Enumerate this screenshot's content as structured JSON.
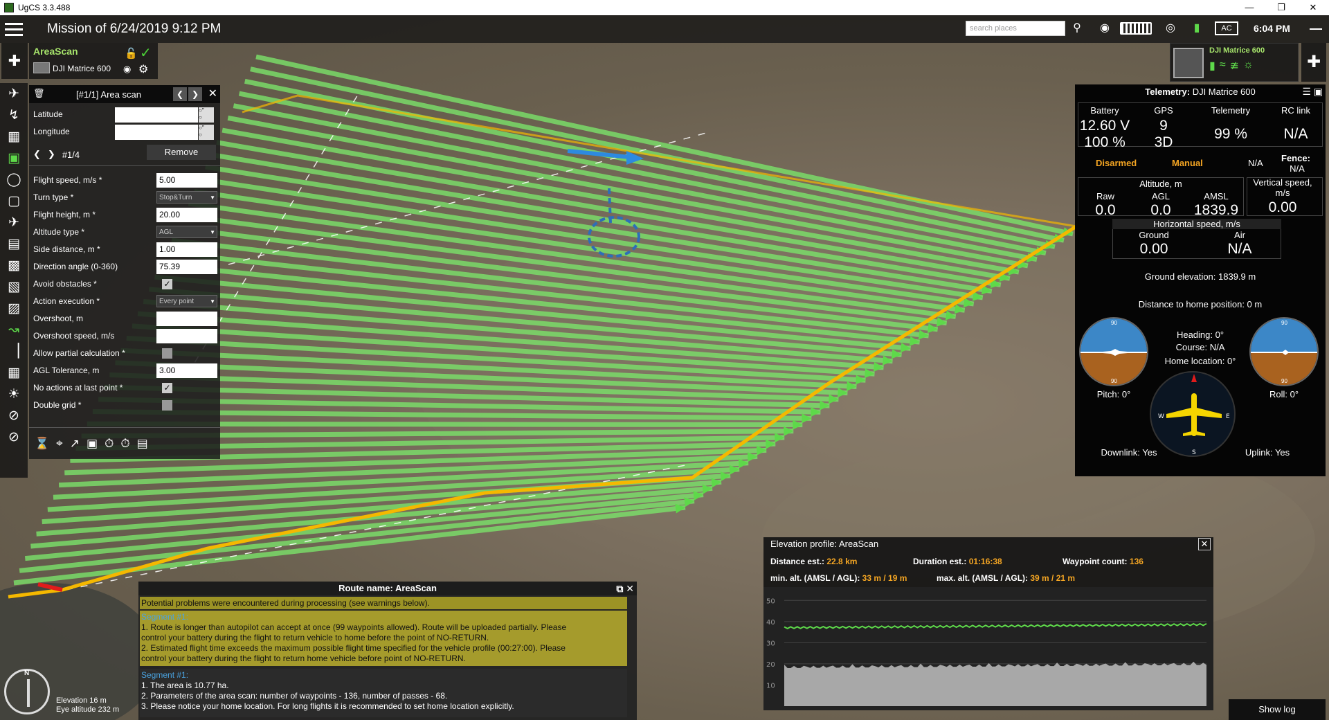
{
  "window": {
    "title": "UgCS 3.3.488",
    "controls": [
      "—",
      "❐",
      "✕"
    ]
  },
  "topbar": {
    "mission_title": "Mission of 6/24/2019 9:12 PM",
    "search_placeholder": "search places",
    "ac_label": "AC",
    "clock": "6:04 PM"
  },
  "route": {
    "name": "AreaScan",
    "vehicle": "DJI Matrice 600"
  },
  "scan_panel": {
    "title": "[#1/1] Area scan",
    "latitude_label": "Latitude",
    "longitude_label": "Longitude",
    "waypoint_index": "#1/4",
    "remove_label": "Remove",
    "params": [
      {
        "label": "Flight speed, m/s *",
        "kind": "input",
        "value": "5.00"
      },
      {
        "label": "Turn type *",
        "kind": "select",
        "value": "Stop&Turn"
      },
      {
        "label": "Flight height, m *",
        "kind": "input",
        "value": "20.00"
      },
      {
        "label": "Altitude type *",
        "kind": "select",
        "value": "AGL"
      },
      {
        "label": "Side distance, m *",
        "kind": "input",
        "value": "1.00"
      },
      {
        "label": "Direction angle (0-360)",
        "kind": "input",
        "value": "75.39"
      },
      {
        "label": "Avoid obstacles *",
        "kind": "checkbox",
        "checked": true
      },
      {
        "label": "Action execution *",
        "kind": "select",
        "value": "Every point"
      },
      {
        "label": "Overshoot, m",
        "kind": "input",
        "value": ""
      },
      {
        "label": "Overshoot speed, m/s",
        "kind": "input",
        "value": ""
      },
      {
        "label": "Allow partial calculation *",
        "kind": "checkbox",
        "checked": false
      },
      {
        "label": "AGL Tolerance, m",
        "kind": "input",
        "value": "3.00"
      },
      {
        "label": "No actions at last point *",
        "kind": "checkbox",
        "checked": true
      },
      {
        "label": "Double grid *",
        "kind": "checkbox",
        "checked": false
      }
    ]
  },
  "vehicle_card": {
    "name": "DJI Matrice 600"
  },
  "telemetry": {
    "header_label": "Telemetry:",
    "vehicle": "DJI Matrice 600",
    "battery_label": "Battery",
    "battery_voltage": "12.60 V",
    "battery_percent": "100 %",
    "gps_label": "GPS",
    "gps_sats": "9",
    "gps_fix": "3D",
    "telemetry_label": "Telemetry",
    "telemetry_value": "99 %",
    "rclink_label": "RC link",
    "rclink_value": "N/A",
    "armed_status": "Disarmed",
    "mode_status": "Manual",
    "na_status": "N/A",
    "fence_label": "Fence:",
    "fence_value": "N/A",
    "altitude_label": "Altitude, m",
    "raw_label": "Raw",
    "raw_value": "0.0",
    "agl_label": "AGL",
    "agl_value": "0.0",
    "amsl_label": "AMSL",
    "amsl_value": "1839.9",
    "vspeed_label": "Vertical speed, m/s",
    "vspeed_value": "0.00",
    "hspeed_label": "Horizontal speed, m/s",
    "ground_label": "Ground",
    "ground_value": "0.00",
    "air_label": "Air",
    "air_value": "N/A",
    "ground_elevation": "Ground elevation: 1839.9 m",
    "home_distance": "Distance to home position: 0 m",
    "heading": "Heading: 0°",
    "course": "Course: N/A",
    "home_location": "Home location: 0°",
    "pitch": "Pitch: 0°",
    "roll": "Roll: 0°",
    "downlink": "Downlink: Yes",
    "uplink": "Uplink: Yes",
    "dial_top": "90",
    "dial_bottom": "90"
  },
  "warnings": {
    "title": "Route name: AreaScan",
    "summary": "Potential problems were encountered during processing (see warnings below).",
    "segment_warn": "Segment #1:",
    "warn_lines": [
      "1. Route is longer than autopilot can accept at once (99 waypoints allowed). Route will be uploaded partially. Please",
      "control your battery during the flight to return vehicle to home before the point of NO-RETURN.",
      "2. Estimated flight time exceeds the maximum possible flight time specified for the vehicle profile (00:27:00). Please",
      "control your battery during the flight to return home vehicle before point of NO-RETURN."
    ],
    "segment_info": "Segment #1:",
    "info_lines": [
      "1. The area is 10.77 ha.",
      "2. Parameters of the area scan: number of waypoints - 136, number of passes - 68.",
      "3. Please notice your home location. For long flights it is recommended to set home location explicitly."
    ]
  },
  "elevation": {
    "title": "Elevation profile: AreaScan",
    "distance_label": "Distance est.:",
    "distance_value": "22.8 km",
    "duration_label": "Duration est.:",
    "duration_value": "01:16:38",
    "waypoint_label": "Waypoint count:",
    "waypoint_value": "136",
    "minalt_label": "min. alt. (AMSL / AGL):",
    "minalt_value": "33 m / 19 m",
    "maxalt_label": "max. alt. (AMSL / AGL):",
    "maxalt_value": "39 m / 21 m",
    "y_ticks": [
      "50",
      "40",
      "30",
      "20",
      "10"
    ]
  },
  "map": {
    "elevation_text": "Elevation 16 m",
    "eye_altitude_text": "Eye altitude 232 m",
    "compass_north": "N"
  },
  "show_log_label": "Show log",
  "colors": {
    "route_green": "#5ed94a",
    "accent_orange": "#f5a623",
    "warning_yellow": "#a59b2c",
    "segment_blue": "#4aa3e0"
  }
}
